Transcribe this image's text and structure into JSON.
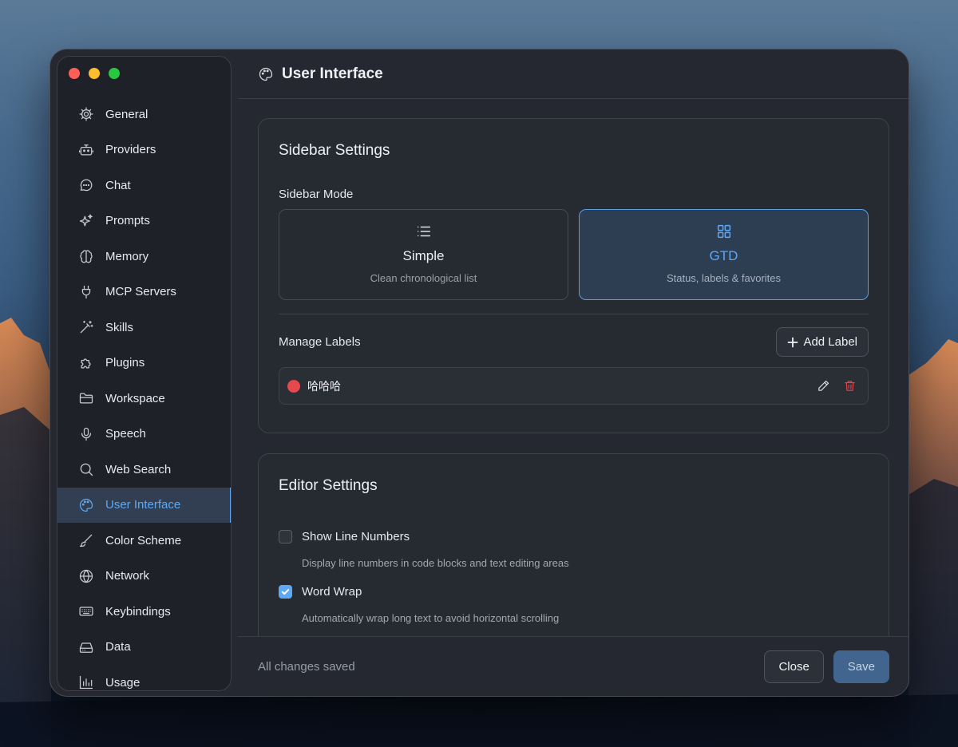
{
  "window": {
    "title": "User Interface"
  },
  "sidebar": {
    "items": [
      {
        "label": "General",
        "icon": "gear-icon"
      },
      {
        "label": "Providers",
        "icon": "bot-icon"
      },
      {
        "label": "Chat",
        "icon": "chat-bubble-icon"
      },
      {
        "label": "Prompts",
        "icon": "sparkles-icon"
      },
      {
        "label": "Memory",
        "icon": "brain-icon"
      },
      {
        "label": "MCP Servers",
        "icon": "plug-icon"
      },
      {
        "label": "Skills",
        "icon": "magic-wand-icon"
      },
      {
        "label": "Plugins",
        "icon": "puzzle-icon"
      },
      {
        "label": "Workspace",
        "icon": "folder-icon"
      },
      {
        "label": "Speech",
        "icon": "microphone-icon"
      },
      {
        "label": "Web Search",
        "icon": "search-icon"
      },
      {
        "label": "User Interface",
        "icon": "palette-icon",
        "active": true
      },
      {
        "label": "Color Scheme",
        "icon": "brush-icon"
      },
      {
        "label": "Network",
        "icon": "globe-icon"
      },
      {
        "label": "Keybindings",
        "icon": "keyboard-icon"
      },
      {
        "label": "Data",
        "icon": "hard-drive-icon"
      },
      {
        "label": "Usage",
        "icon": "bar-chart-icon"
      }
    ]
  },
  "sidebar_settings": {
    "title": "Sidebar Settings",
    "mode_label": "Sidebar Mode",
    "modes": [
      {
        "title": "Simple",
        "desc": "Clean chronological list",
        "selected": false
      },
      {
        "title": "GTD",
        "desc": "Status, labels & favorites",
        "selected": true
      }
    ],
    "manage_labels": "Manage Labels",
    "add_label": "Add Label",
    "labels": [
      {
        "name": "哈哈哈",
        "color": "#e5484d"
      }
    ]
  },
  "editor_settings": {
    "title": "Editor Settings",
    "options": [
      {
        "label": "Show Line Numbers",
        "desc": "Display line numbers in code blocks and text editing areas",
        "checked": false
      },
      {
        "label": "Word Wrap",
        "desc": "Automatically wrap long text to avoid horizontal scrolling",
        "checked": true
      }
    ]
  },
  "footer": {
    "status": "All changes saved",
    "close": "Close",
    "save": "Save"
  },
  "colors": {
    "accent": "#5fa8f3",
    "danger": "#e5484d",
    "save_button": "#41658e"
  }
}
